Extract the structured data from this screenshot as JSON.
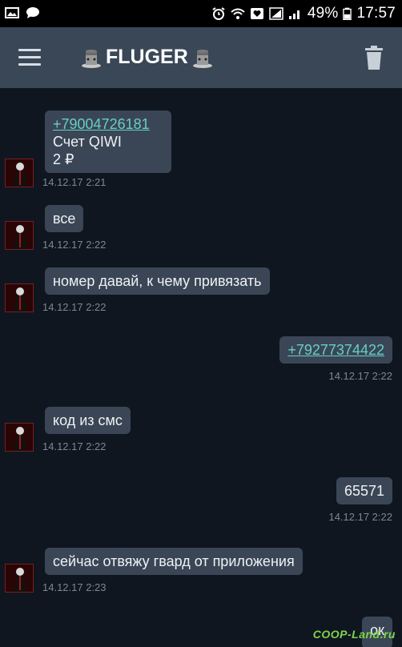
{
  "status_bar": {
    "battery_percent": "49%",
    "time": "17:57",
    "icons": [
      "gallery-icon",
      "chat-bubble-icon",
      "alarm-icon",
      "wifi-icon",
      "heart-icon",
      "signal-icon",
      "signal-icon",
      "battery-icon"
    ]
  },
  "app_bar": {
    "title": "FLUGER",
    "left_icon": "menu-icon",
    "right_icon": "trash-icon",
    "title_decor_icon": "mafia-hat-icon"
  },
  "messages": [
    {
      "side": "in",
      "lines": [
        "+79004726181",
        "Счет QIWI",
        "2 ₽"
      ],
      "link_line": 0,
      "time": "14.12.17 2:21"
    },
    {
      "side": "in",
      "lines": [
        "все"
      ],
      "time": "14.12.17 2:22"
    },
    {
      "side": "in",
      "lines": [
        "номер давай, к чему привязать"
      ],
      "time": "14.12.17 2:22"
    },
    {
      "side": "out",
      "lines": [
        "+79277374422"
      ],
      "link_line": 0,
      "time": "14.12.17 2:22"
    },
    {
      "side": "in",
      "lines": [
        "код из смс"
      ],
      "time": "14.12.17 2:22"
    },
    {
      "side": "out",
      "lines": [
        "65571"
      ],
      "time": "14.12.17 2:22"
    },
    {
      "side": "in",
      "lines": [
        "сейчас отвяжу гвард от приложения"
      ],
      "time": "14.12.17 2:23"
    },
    {
      "side": "out",
      "lines": [
        "ок"
      ],
      "time": ""
    }
  ],
  "watermark": "COOP-Land.ru",
  "colors": {
    "background": "#0f1620",
    "app_bar": "#3a4757",
    "bubble": "#3a4656",
    "link": "#66cfc4"
  }
}
